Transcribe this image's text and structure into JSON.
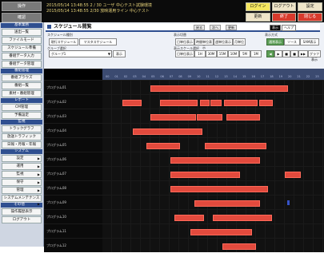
{
  "topbar": {
    "left_buttons": [
      "操作",
      "確認"
    ],
    "status_lines": [
      "2015/05/14 13:48:55  2 / 30 ユーザ  中心テスト試験環境",
      "2015/05/14 13:48:55  2/30 放映運用ライン 中心テスト"
    ],
    "right_buttons": [
      {
        "label": "ログイン",
        "style": "yellow"
      },
      {
        "label": "ログアウト",
        "style": "normal"
      },
      {
        "label": "設定",
        "style": "normal"
      },
      {
        "label": "更新",
        "style": "normal"
      },
      {
        "label": "終了",
        "style": "red"
      },
      {
        "label": "閉じる",
        "style": "red"
      }
    ]
  },
  "sidebar": {
    "sections": [
      {
        "title": "基本業務",
        "items": [
          {
            "label": "送出一覧",
            "tri": false
          },
          {
            "label": "ファイルモード",
            "tri": false
          },
          {
            "label": "スケジュール準備",
            "tri": false
          },
          {
            "label": "番組データ入力",
            "tri": false
          },
          {
            "label": "番組データ管理",
            "tri": false
          }
        ]
      },
      {
        "title": "番組管理",
        "items": [
          {
            "label": "番組ブラウズ",
            "tri": false
          },
          {
            "label": "番組一覧",
            "tri": false
          },
          {
            "label": "素材・番組管理",
            "tri": false
          }
        ]
      },
      {
        "title": "レポート",
        "items": [
          {
            "label": "CM管理",
            "tri": false
          },
          {
            "label": "予備設定",
            "tri": false
          }
        ]
      },
      {
        "title": "監視",
        "items": [
          {
            "label": "トラックグラフ",
            "tri": false
          },
          {
            "label": "放送トラフィック",
            "tri": false
          },
          {
            "label": "日報・月報・年報",
            "tri": false
          }
        ]
      },
      {
        "title": "システム",
        "items": [
          {
            "label": "設定",
            "tri": true
          },
          {
            "label": "運用",
            "tri": true
          },
          {
            "label": "監視",
            "tri": true
          },
          {
            "label": "保守",
            "tri": true
          },
          {
            "label": "管理",
            "tri": true
          }
        ]
      },
      {
        "title": "",
        "items": [
          {
            "label": "システムメンテナンス",
            "tri": true
          }
        ]
      },
      {
        "title": "その他",
        "items": [
          {
            "label": "操作履歴表示",
            "tri": false
          },
          {
            "label": "ログアウト",
            "tri": false
          }
        ]
      }
    ]
  },
  "main": {
    "title": "スケジュール閲覧",
    "mini_buttons": [
      "戻る",
      "次へ",
      "更新"
    ],
    "tabs": [
      {
        "label": "表示",
        "active": true
      },
      {
        "label": "ヘルプ",
        "active": false
      }
    ],
    "schedule_group_label": "スケジュール種別",
    "schedule_buttons": [
      "現行スケジュール",
      "マスタスケジュール"
    ],
    "group_label": "グループ選択",
    "group_select": "グループ1",
    "group_button": "表示",
    "display_label": "表示切替",
    "display_buttons": [
      "日単位表示",
      "時間単位表示",
      "週単位表示",
      "月単位"
    ],
    "range_label": "表示スケール選択",
    "range_buttons": [
      "日単位表示",
      "1H",
      "30M",
      "15M",
      "10M",
      "5M",
      "1M"
    ],
    "right_label": "表示方式",
    "right_buttons": [
      {
        "label": "通常表示",
        "style": "blue"
      },
      {
        "label": "ソース",
        "style": "normal"
      },
      {
        "label": "SAM表示",
        "style": "normal"
      }
    ],
    "nav_buttons": [
      "◀",
      "▶",
      "■",
      "■",
      "▶▶"
    ],
    "nav_tail": "グラフ表示"
  },
  "gantt": {
    "header_ticks": [
      "00",
      "01",
      "02",
      "03",
      "04",
      "05",
      "06",
      "07",
      "08",
      "09",
      "10",
      "11",
      "12",
      "13",
      "14",
      "15",
      "16",
      "17",
      "18",
      "19",
      "20",
      "21",
      "22",
      "23"
    ],
    "rows": [
      {
        "label": "プログラム01"
      },
      {
        "label": "プログラム02"
      },
      {
        "label": "プログラム03"
      },
      {
        "label": "プログラム04"
      },
      {
        "label": "プログラム05"
      },
      {
        "label": "プログラム06"
      },
      {
        "label": "プログラム07"
      },
      {
        "label": "プログラム08"
      },
      {
        "label": "プログラム09"
      },
      {
        "label": "プログラム10"
      },
      {
        "label": "プログラム11"
      },
      {
        "label": "プログラム12"
      }
    ]
  },
  "colors": {
    "accent": "#2f4f90",
    "bar": "#e24a3d",
    "background": "#000000"
  }
}
